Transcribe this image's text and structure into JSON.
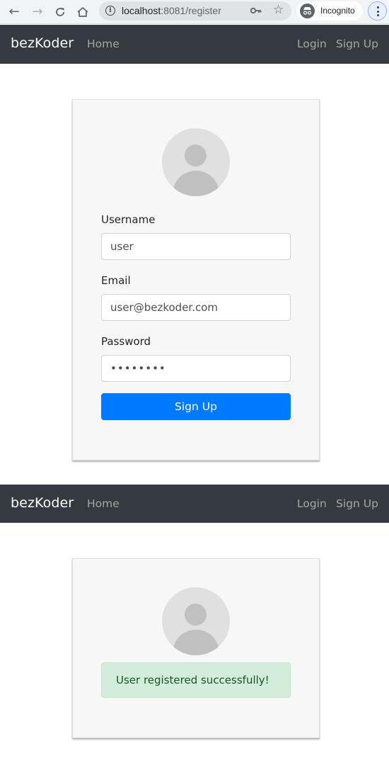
{
  "browser": {
    "url_host": "localhost",
    "url_rest": ":8081/register",
    "profile_label": "Incognito",
    "icons": [
      "back-arrow-icon",
      "forward-arrow-icon",
      "reload-icon",
      "home-icon",
      "info-icon",
      "key-icon",
      "star-icon",
      "incognito-icon",
      "menu-icon"
    ]
  },
  "navbar": {
    "brand": "bezKoder",
    "home": "Home",
    "login": "Login",
    "signup": "Sign Up",
    "background_color": "#343a40"
  },
  "register_form": {
    "username_label": "Username",
    "username_value": "user",
    "email_label": "Email",
    "email_value": "user@bezkoder.com",
    "password_label": "Password",
    "password_value": "password",
    "submit_label": "Sign Up",
    "submit_color": "#007bff"
  },
  "success_view": {
    "message": "User registered successfully!",
    "alert_color": "#d4edda"
  }
}
